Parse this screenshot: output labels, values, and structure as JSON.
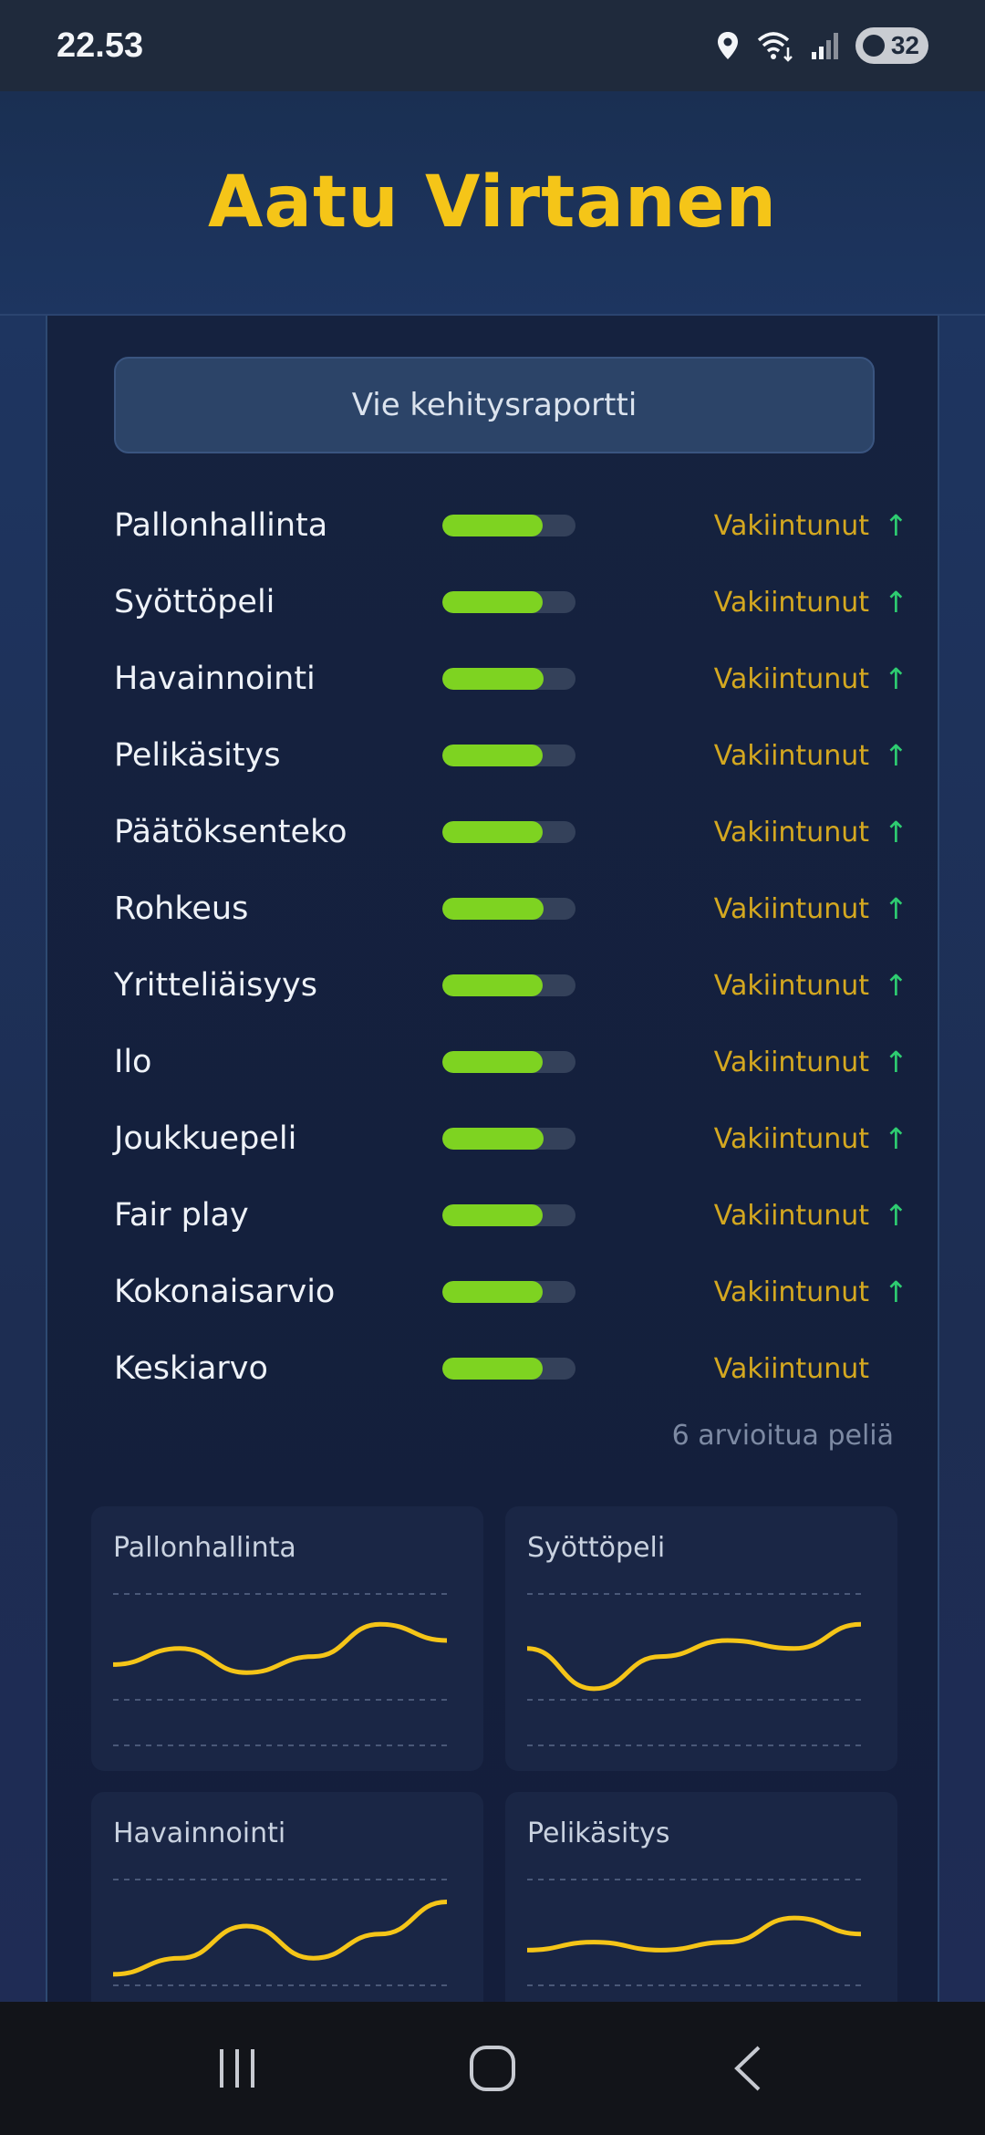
{
  "status_bar": {
    "time": "22.53",
    "battery": "32",
    "icons": [
      "location-icon",
      "wifi-icon",
      "signal-icon",
      "battery-icon"
    ]
  },
  "header": {
    "title": "Aatu Virtanen"
  },
  "export_button": {
    "label": "Vie kehitysraportti"
  },
  "skills": [
    {
      "label": "Pallonhallinta",
      "level": 0.75,
      "status": "Vakiintunut",
      "trend": "↑"
    },
    {
      "label": "Syöttöpeli",
      "level": 0.75,
      "status": "Vakiintunut",
      "trend": "↑"
    },
    {
      "label": "Havainnointi",
      "level": 0.76,
      "status": "Vakiintunut",
      "trend": "↑"
    },
    {
      "label": "Pelikäsitys",
      "level": 0.75,
      "status": "Vakiintunut",
      "trend": "↑"
    },
    {
      "label": "Päätöksenteko",
      "level": 0.75,
      "status": "Vakiintunut",
      "trend": "↑"
    },
    {
      "label": "Rohkeus",
      "level": 0.76,
      "status": "Vakiintunut",
      "trend": "↑"
    },
    {
      "label": "Yritteliäisyys",
      "level": 0.75,
      "status": "Vakiintunut",
      "trend": "↑"
    },
    {
      "label": "Ilo",
      "level": 0.75,
      "status": "Vakiintunut",
      "trend": "↑"
    },
    {
      "label": "Joukkuepeli",
      "level": 0.76,
      "status": "Vakiintunut",
      "trend": "↑"
    },
    {
      "label": "Fair play",
      "level": 0.75,
      "status": "Vakiintunut",
      "trend": "↑"
    },
    {
      "label": "Kokonaisarvio",
      "level": 0.75,
      "status": "Vakiintunut",
      "trend": "↑"
    },
    {
      "label": "Keskiarvo",
      "level": 0.75,
      "status": "Vakiintunut",
      "trend": ""
    }
  ],
  "games_count": "6 arvioitua peliä",
  "mini_charts": [
    {
      "title": "Pallonhallinta",
      "values": [
        3.3,
        3.5,
        3.2,
        3.4,
        3.8,
        3.6
      ]
    },
    {
      "title": "Syöttöpeli",
      "values": [
        3.5,
        3.0,
        3.4,
        3.6,
        3.5,
        3.8
      ]
    },
    {
      "title": "Havainnointi",
      "values": [
        3.0,
        3.2,
        3.6,
        3.2,
        3.5,
        3.9
      ]
    },
    {
      "title": "Pelikäsitys",
      "values": [
        3.3,
        3.4,
        3.3,
        3.4,
        3.7,
        3.5
      ]
    }
  ],
  "colors": {
    "accent_yellow": "#f5c518",
    "bar_fill": "#7ed321",
    "status_text": "#d4a820",
    "trend_up": "#2ecc71",
    "line": "#f5c518"
  },
  "nav": [
    "recent-apps-icon",
    "home-icon",
    "back-icon"
  ]
}
